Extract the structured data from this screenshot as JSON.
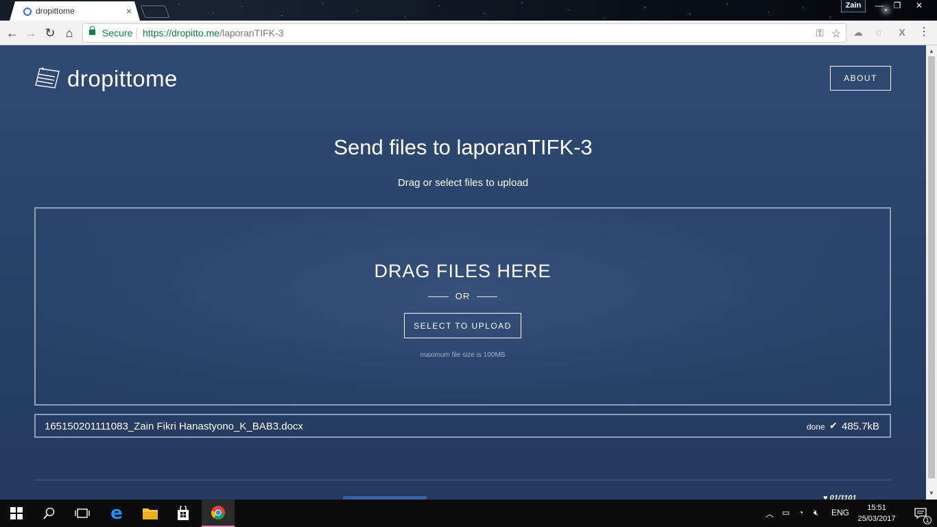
{
  "browser": {
    "tab_title": "dropittome",
    "tab_close": "×",
    "user_name": "Zain",
    "security_label": "Secure",
    "url_origin": "https://dropitto.me",
    "url_path": "/laporanTIFK-3",
    "window_controls": {
      "minimize": "—",
      "restore": "❐",
      "close": "✕"
    },
    "nav": {
      "back": "←",
      "forward": "→",
      "reload": "↻",
      "home": "⌂"
    },
    "omnibox_icons": {
      "key": "⚿",
      "star": "☆"
    },
    "extensions": [
      "cloud-icon",
      "ghost-icon",
      "x-icon",
      "menu-icon"
    ],
    "menu_icon": "⋮"
  },
  "page": {
    "logo_text": "dropittome",
    "about_label": "ABOUT",
    "heading": "Send files to laporanTIFK-3",
    "subheading": "Drag or select files to upload",
    "dropzone": {
      "title": "DRAG FILES HERE",
      "or_label": "OR",
      "select_label": "SELECT TO UPLOAD",
      "max_size_note": "maximum file size is 100MB"
    },
    "files": [
      {
        "name": "165150201111083_Zain Fikri Hanastyono_K_BAB3.docx",
        "status": "done",
        "size": "485.7kB"
      }
    ],
    "footer_brand": "♥ 01/1101"
  },
  "taskbar": {
    "pinned": [
      "windows-start-icon",
      "search-icon",
      "task-view-icon",
      "edge-icon",
      "file-explorer-icon",
      "store-icon",
      "chrome-icon"
    ],
    "language": "ENG",
    "time": "15:51",
    "date": "25/03/2017",
    "notification_count": "1"
  },
  "colors": {
    "page_bg": "#2c4670",
    "secure_green": "#0b8043",
    "border": "#8ea0bd",
    "taskbar_bg": "#0b0b0b",
    "chrome_active_underline": "#d98db4"
  }
}
